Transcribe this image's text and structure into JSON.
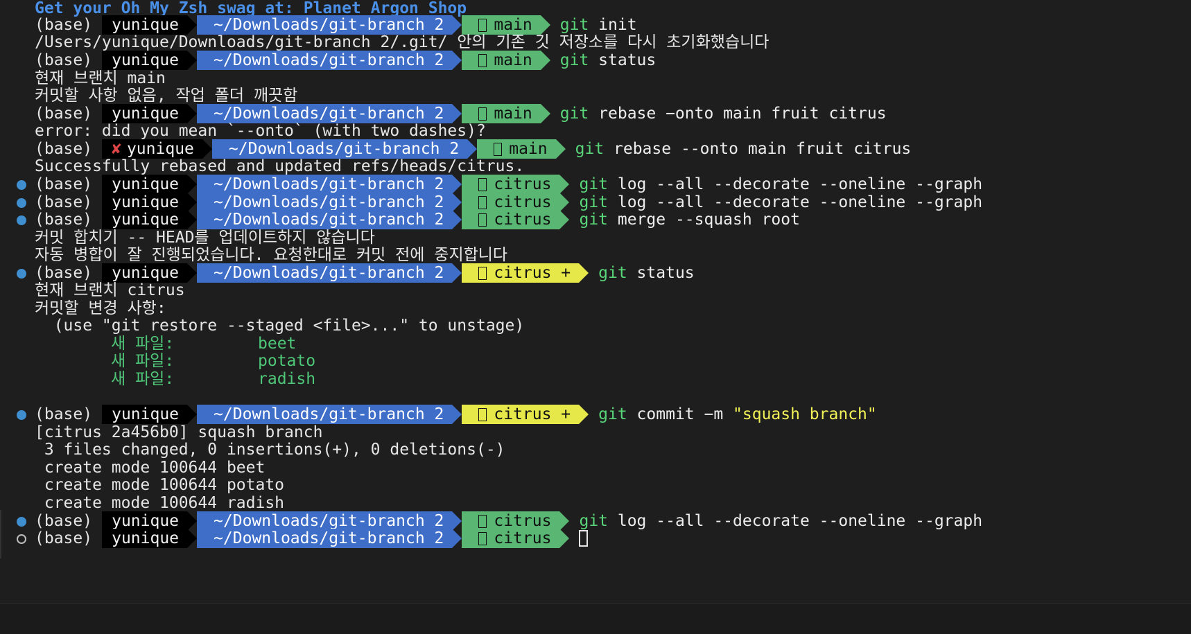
{
  "banner": "Get your Oh My Zsh swag at: Planet Argon Shop",
  "prompts": [
    {
      "base": "(base)",
      "user": "yunique",
      "path": "~/Downloads/git-branch 2",
      "branch": "main",
      "cmd_git": "git",
      "cmd_rest": " init"
    },
    {
      "base": "(base)",
      "user": "yunique",
      "path": "~/Downloads/git-branch 2",
      "branch": "main",
      "cmd_git": "git",
      "cmd_rest": " status"
    },
    {
      "base": "(base)",
      "user": "yunique",
      "path": "~/Downloads/git-branch 2",
      "branch": "main",
      "cmd_git": "git",
      "cmd_rest": " rebase −onto main fruit citrus"
    },
    {
      "base": "(base)",
      "error_mark": "✘",
      "user": "yunique",
      "path": "~/Downloads/git-branch 2",
      "branch": "main",
      "cmd_git": "git",
      "cmd_rest": " rebase --onto main fruit citrus"
    },
    {
      "base": "(base)",
      "user": "yunique",
      "path": "~/Downloads/git-branch 2",
      "branch": "citrus",
      "cmd_git": "git",
      "cmd_rest": " log --all --decorate --oneline --graph"
    },
    {
      "base": "(base)",
      "user": "yunique",
      "path": "~/Downloads/git-branch 2",
      "branch": "citrus",
      "cmd_git": "git",
      "cmd_rest": " log --all --decorate --oneline --graph"
    },
    {
      "base": "(base)",
      "user": "yunique",
      "path": "~/Downloads/git-branch 2",
      "branch": "citrus",
      "cmd_git": "git",
      "cmd_rest": " merge --squash root"
    },
    {
      "base": "(base)",
      "user": "yunique",
      "path": "~/Downloads/git-branch 2",
      "branch": "citrus +",
      "cmd_git": "git",
      "cmd_rest": " status"
    },
    {
      "base": "(base)",
      "user": "yunique",
      "path": "~/Downloads/git-branch 2",
      "branch": "citrus +",
      "cmd_git": "git",
      "cmd_rest": " commit −m ",
      "cmd_str": "\"squash branch\""
    },
    {
      "base": "(base)",
      "user": "yunique",
      "path": "~/Downloads/git-branch 2",
      "branch": "citrus",
      "cmd_git": "git",
      "cmd_rest": " log --all --decorate --oneline --graph"
    },
    {
      "base": "(base)",
      "user": "yunique",
      "path": "~/Downloads/git-branch 2",
      "branch": "citrus"
    }
  ],
  "output": {
    "init": "/Users/yunique/Downloads/git-branch 2/.git/ 안의 기존 깃 저장소를 다시 초기화했습니다",
    "status1_branch": "현재 브랜치 main",
    "status1_clean": "커밋할 사항 없음, 작업 폴더 깨끗함",
    "rebase_error": "error: did you mean `--onto` (with two dashes)?",
    "rebase_ok": "Successfully rebased and updated refs/heads/citrus.",
    "merge_1": "커밋 합치기 -- HEAD를 업데이트하지 않습니다",
    "merge_2": "자동 병합이 잘 진행되었습니다. 요청한대로 커밋 전에 중지합니다",
    "status2_branch": "현재 브랜치 citrus",
    "status2_changes": "커밋할 변경 사항:",
    "status2_hint": "  (use \"git restore --staged <file>...\" to unstage)",
    "new_file_label": "새 파일:",
    "new_files": [
      "beet",
      "potato",
      "radish"
    ],
    "commit_1": "[citrus 2a456b0] squash branch",
    "commit_2": " 3 files changed, 0 insertions(+), 0 deletions(-)",
    "commit_modes": [
      " create mode 100644 beet",
      " create mode 100644 potato",
      " create mode 100644 radish"
    ]
  },
  "colors": {
    "path_bg": "#3e6ec8",
    "branch_bg": "#59b673",
    "branch_dirty_bg": "#e6e84a",
    "git_cmd": "#59d67a",
    "new_file": "#4fc778",
    "banner": "#4a8fe8",
    "error_mark": "#e04646"
  }
}
